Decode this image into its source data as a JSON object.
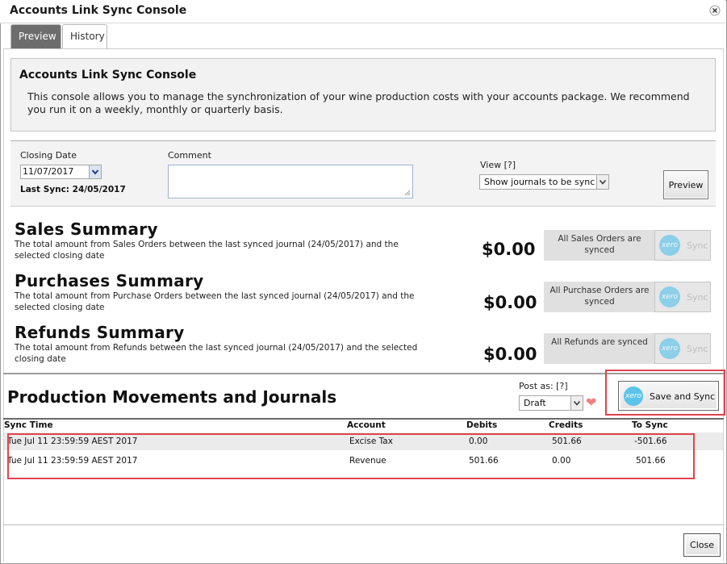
{
  "window": {
    "title": "Accounts Link Sync Console"
  },
  "tabs": [
    {
      "label": "Preview"
    },
    {
      "label": "History"
    }
  ],
  "intro": {
    "title": "Accounts Link Sync Console",
    "body": "This console allows you to manage the synchronization of your wine production costs with your accounts package. We recommend you run it on a weekly, monthly or quarterly basis."
  },
  "filters": {
    "closing_date_label": "Closing Date",
    "closing_date_value": "11/07/2017",
    "last_sync": "Last Sync: 24/05/2017",
    "comment_label": "Comment",
    "comment_value": "",
    "view_label": "View [?]",
    "view_value": "Show journals to be sync",
    "preview_button": "Preview"
  },
  "summaries": [
    {
      "title": "Sales Summary",
      "description": "The total amount from Sales Orders between the last synced journal (24/05/2017) and the selected closing date",
      "amount": "$0.00",
      "status": "All Sales Orders are synced",
      "sync_label": "Sync"
    },
    {
      "title": "Purchases Summary",
      "description": "The total amount from Purchase Orders between the last synced journal (24/05/2017) and the selected closing date",
      "amount": "$0.00",
      "status": "All Purchase Orders are synced",
      "sync_label": "Sync"
    },
    {
      "title": "Refunds Summary",
      "description": "The total amount from Refunds between the last synced journal (24/05/2017) and the selected closing date",
      "amount": "$0.00",
      "status": "All Refunds are synced",
      "sync_label": "Sync"
    }
  ],
  "production": {
    "title": "Production Movements and Journals",
    "post_as_label": "Post as: [?]",
    "post_as_value": "Draft",
    "save_sync_button": "Save and Sync"
  },
  "table": {
    "headers": [
      "Sync Time",
      "Account",
      "Debits",
      "Credits",
      "To Sync"
    ],
    "rows": [
      [
        "Tue Jul 11 23:59:59 AEST 2017",
        "Excise Tax",
        "0.00",
        "501.66",
        "-501.66"
      ],
      [
        "Tue Jul 11 23:59:59 AEST 2017",
        "Revenue",
        "501.66",
        "0.00",
        "501.66"
      ]
    ]
  },
  "footer": {
    "close_button": "Close"
  },
  "icons": {
    "xero_logo_text": "xero",
    "brand_color": "#5cc4ea",
    "highlight_color": "#e0434c"
  }
}
